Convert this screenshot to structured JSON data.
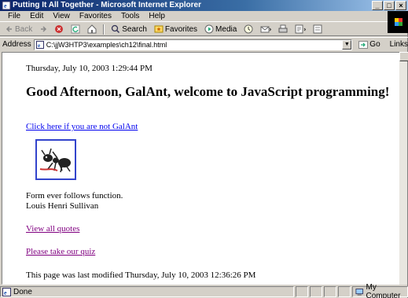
{
  "window": {
    "title": "Putting It All Together - Microsoft Internet Explorer",
    "controls": {
      "minimize": "_",
      "maximize": "□",
      "close": "×"
    }
  },
  "menu": [
    "File",
    "Edit",
    "View",
    "Favorites",
    "Tools",
    "Help"
  ],
  "toolbar": {
    "back": "Back",
    "search": "Search",
    "favorites": "Favorites",
    "media": "Media"
  },
  "address": {
    "label": "Address",
    "value": "C:\\jjW3HTP3\\examples\\ch12\\final.html",
    "go": "Go",
    "links": "Links"
  },
  "page": {
    "date": "Thursday, July 10, 2003 1:29:44 PM",
    "greeting": "Good Afternoon, GalAnt, welcome to JavaScript programming!",
    "not_user_link": "Click here if you are not GalAnt",
    "quote_text": "Form ever follows function.",
    "quote_author": "Louis Henri Sullivan",
    "quotes_link": "View all quotes",
    "quiz_link": "Please take our quiz",
    "last_modified": "This page was last modified Thursday, July 10, 2003 12:36:26 PM"
  },
  "status": {
    "text": "Done",
    "zone": "My Computer"
  },
  "icons": {
    "app": "ie-page-icon",
    "image": "ant-icon"
  },
  "colors": {
    "link": "#0000ee",
    "visited": "#800080",
    "titlebar": "#0a246a"
  }
}
